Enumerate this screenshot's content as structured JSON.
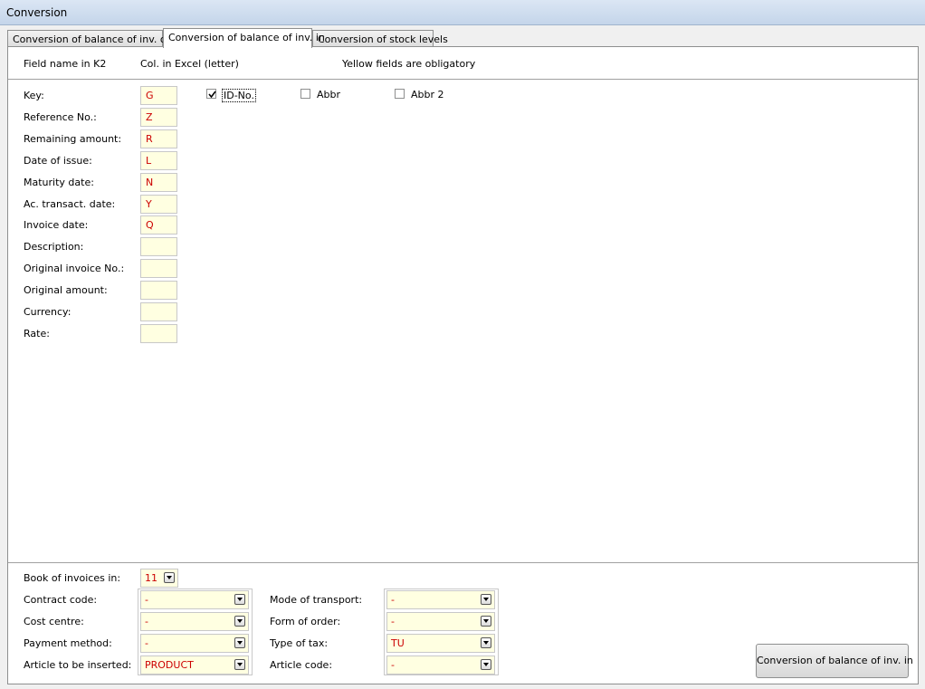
{
  "window": {
    "title": "Conversion"
  },
  "tabs": [
    {
      "label": "Conversion of balance of inv. out"
    },
    {
      "label": "Conversion of balance of inv. in"
    },
    {
      "label": "Conversion of stock levels"
    }
  ],
  "header": {
    "field_name": "Field name in K2",
    "col_excel": "Col. in Excel (letter)",
    "note": "Yellow fields are obligatory"
  },
  "fields": [
    {
      "label": "Key:",
      "value": "G"
    },
    {
      "label": "Reference No.:",
      "value": "Z"
    },
    {
      "label": "Remaining amount:",
      "value": "R"
    },
    {
      "label": "Date of issue:",
      "value": "L"
    },
    {
      "label": "Maturity date:",
      "value": "N"
    },
    {
      "label": "Ac. transact. date:",
      "value": "Y"
    },
    {
      "label": "Invoice date:",
      "value": "Q"
    },
    {
      "label": "Description:",
      "value": ""
    },
    {
      "label": "Original invoice No.:",
      "value": ""
    },
    {
      "label": "Original amount:",
      "value": ""
    },
    {
      "label": "Currency:",
      "value": ""
    },
    {
      "label": "Rate:",
      "value": ""
    }
  ],
  "key_options": [
    {
      "label": "ID-No.",
      "checked": true
    },
    {
      "label": "Abbr",
      "checked": false
    },
    {
      "label": "Abbr 2",
      "checked": false
    }
  ],
  "bottom": {
    "book": {
      "label": "Book of invoices in:",
      "value": "11"
    },
    "left": [
      {
        "label": "Contract code:",
        "value": "-"
      },
      {
        "label": "Cost centre:",
        "value": "-"
      },
      {
        "label": "Payment method:",
        "value": "-"
      },
      {
        "label": "Article to be inserted:",
        "value": "PRODUCT"
      }
    ],
    "right": [
      {
        "label": "Mode of transport:",
        "value": "-"
      },
      {
        "label": "Form of order:",
        "value": "-"
      },
      {
        "label": "Type of tax:",
        "value": "TU"
      },
      {
        "label": "Article code:",
        "value": "-"
      }
    ]
  },
  "action": {
    "label": "Conversion of balance of inv. in"
  }
}
